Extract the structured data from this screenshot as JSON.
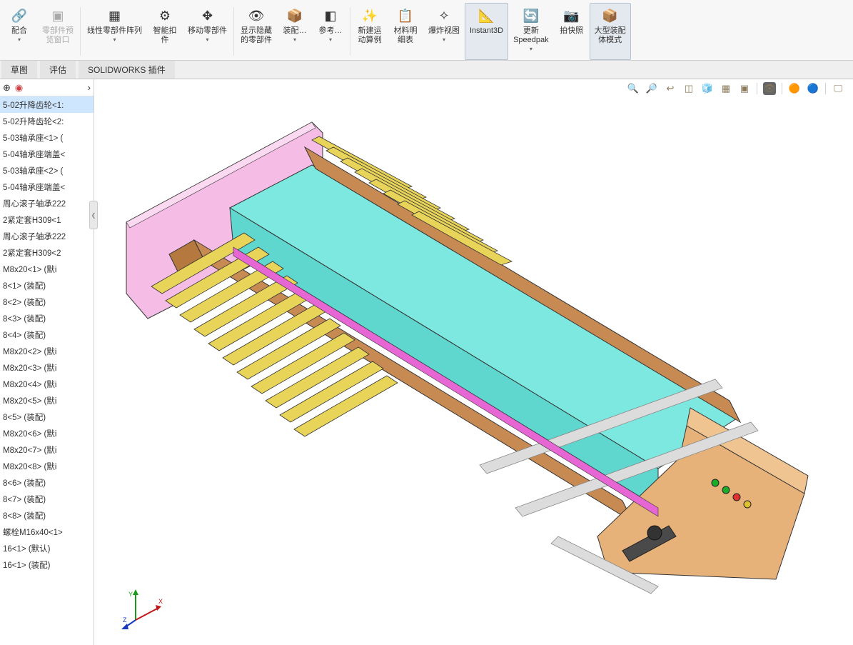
{
  "ribbon": {
    "mate": "配合",
    "preview_window": "零部件预\n览窗口",
    "linear_pattern": "线性零部件阵列",
    "smart_fastener": "智能扣\n件",
    "move_component": "移动零部件",
    "show_hidden": "显示隐藏\n的零部件",
    "assembly": "装配…",
    "reference": "参考…",
    "new_motion": "新建运\n动算例",
    "bom": "材料明\n细表",
    "exploded": "爆炸视图",
    "instant3d": "Instant3D",
    "update_speedpak": "更新\nSpeedpak",
    "take_snapshot": "拍快照",
    "large_assembly": "大型装配\n体模式"
  },
  "tabs": {
    "sketch": "草图",
    "evaluate": "评估",
    "addins": "SOLIDWORKS 插件"
  },
  "tree": {
    "items": [
      "5-02升降齿轮<1:",
      "5-02升降齿轮<2:",
      "5-03轴承座<1> (",
      "5-04轴承座端盖<",
      "5-03轴承座<2> (",
      "5-04轴承座端盖<",
      "周心滚子轴承222",
      "2紧定套H309<1",
      "周心滚子轴承222",
      "2紧定套H309<2",
      "M8x20<1> (默i",
      "8<1> (装配)",
      "8<2> (装配)",
      "8<3> (装配)",
      "8<4> (装配)",
      "M8x20<2> (默i",
      "M8x20<3> (默i",
      "M8x20<4> (默i",
      "M8x20<5> (默i",
      "8<5> (装配)",
      "M8x20<6> (默i",
      "M8x20<7> (默i",
      "M8x20<8> (默i",
      "8<6> (装配)",
      "8<7> (装配)",
      "8<8> (装配)",
      "螺栓M16x40<1>",
      "16<1> (默认)",
      "16<1> (装配)"
    ]
  },
  "triad": {
    "x": "X",
    "y": "Y",
    "z": "Z"
  }
}
